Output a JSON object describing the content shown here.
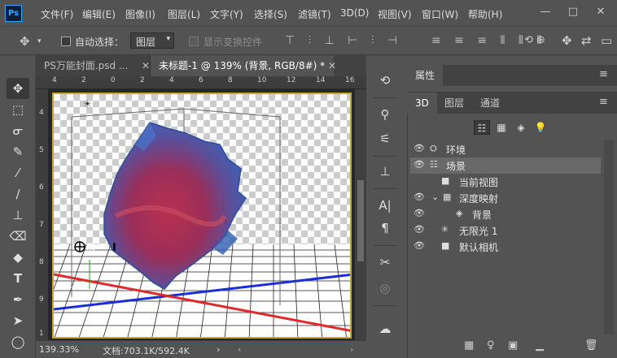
{
  "app": {
    "logo": "Ps"
  },
  "menu": [
    "文件(F)",
    "编辑(E)",
    "图像(I)",
    "图层(L)",
    "文字(Y)",
    "选择(S)",
    "滤镜(T)",
    "3D(D)",
    "视图(V)",
    "窗口(W)",
    "帮助(H)"
  ],
  "window_controls": {
    "minimize": "—",
    "maximize": "□",
    "close": "✕"
  },
  "options": {
    "move_icon": "move-icon",
    "auto_select_label": "自动选择：",
    "auto_select_value": "图层",
    "show_transform_label": "显示变换控件"
  },
  "tabs": [
    {
      "label": "PS万能封面.psd ...",
      "close": "✕"
    },
    {
      "label": "未标题-1 @ 139% (背景, RGB/8#) *",
      "close": "✕"
    }
  ],
  "rulers": {
    "top": [
      "4",
      "2",
      "0",
      "2",
      "4",
      "6",
      "8",
      "10",
      "12",
      "14",
      "16"
    ],
    "left": [
      "4",
      "5",
      "6",
      "7",
      "8",
      "9",
      "1"
    ]
  },
  "status": {
    "zoom": "139.33%",
    "doc": "文档:703.1K/592.4K",
    "arrow": "›"
  },
  "properties": {
    "title": "属性",
    "menu": "≡"
  },
  "panel3d": {
    "tabs": [
      "3D",
      "图层",
      "通道"
    ],
    "menu": "≡",
    "items": [
      {
        "label": "环境",
        "icon": "environment-icon",
        "eye": true,
        "indent": 0
      },
      {
        "label": "场景",
        "icon": "scene-icon",
        "eye": true,
        "indent": 0,
        "selected": true
      },
      {
        "label": "当前视图",
        "icon": "camera-icon",
        "eye": false,
        "indent": 1
      },
      {
        "label": "深度映射",
        "icon": "mesh-icon",
        "eye": true,
        "indent": 1,
        "expanded": true
      },
      {
        "label": "背景",
        "icon": "material-icon",
        "eye": true,
        "indent": 2
      },
      {
        "label": "无限光 1",
        "icon": "light-icon",
        "eye": true,
        "indent": 1
      },
      {
        "label": "默认相机",
        "icon": "camera-icon",
        "eye": true,
        "indent": 1
      }
    ]
  }
}
